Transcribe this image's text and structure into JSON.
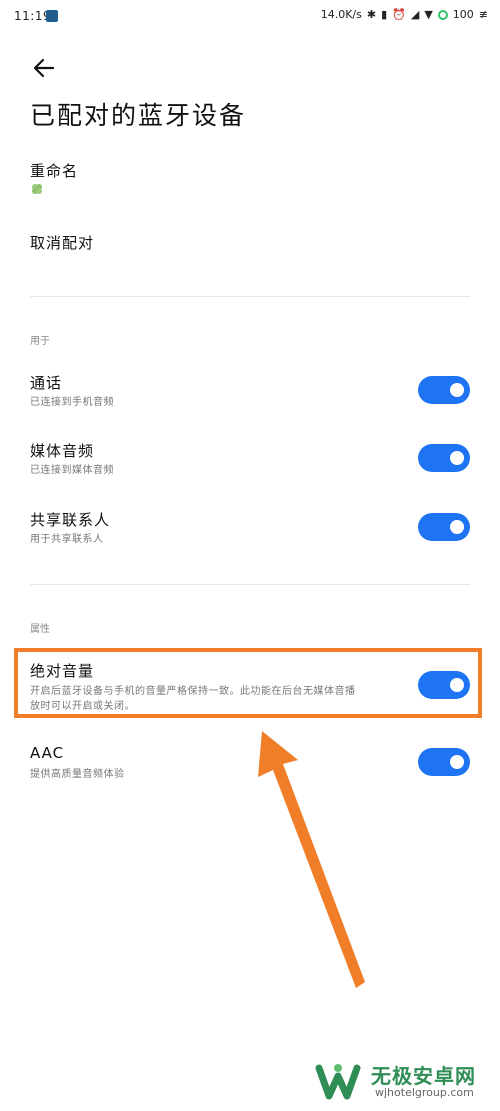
{
  "status_bar": {
    "time": "11:19",
    "network_speed": "14.0K/s",
    "battery": "100"
  },
  "header": {
    "title": "已配对的蓝牙设备"
  },
  "device": {
    "rename_label": "重命名",
    "device_name_icon": "clover-icon",
    "unpair_label": "取消配对"
  },
  "section_use": {
    "label": "用于",
    "items": [
      {
        "title": "通话",
        "subtitle": "已连接到手机音频",
        "enabled": true
      },
      {
        "title": "媒体音频",
        "subtitle": "已连接到媒体音频",
        "enabled": true
      },
      {
        "title": "共享联系人",
        "subtitle": "用于共享联系人",
        "enabled": true
      }
    ]
  },
  "section_props": {
    "label": "属性",
    "items": [
      {
        "title": "绝对音量",
        "subtitle_line1": "开启后蓝牙设备与手机的音量严格保持一致。此功能在后台无媒体音播",
        "subtitle_line2": "放时可以开启或关闭。",
        "enabled": true
      },
      {
        "title": "AAC",
        "subtitle": "提供高质量音频体验",
        "enabled": true
      }
    ]
  },
  "watermark": {
    "name": "无极安卓网",
    "url": "wjhotelgroup.com"
  },
  "colors": {
    "toggle_on": "#1f74f4",
    "highlight": "#f07d28",
    "watermark_green": "#2f8d56"
  }
}
